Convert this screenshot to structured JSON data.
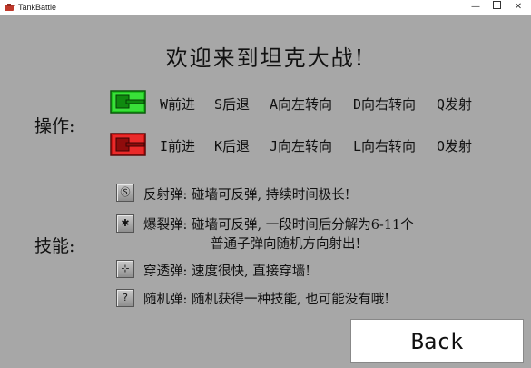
{
  "window": {
    "title": "TankBattle",
    "min_glyph": "—",
    "close_glyph": "✕"
  },
  "welcome": "欢迎来到坦克大战!",
  "operations": {
    "label": "操作:",
    "player1": {
      "tank_color": "#1fc41f",
      "keys": [
        "W前进",
        "S后退",
        "A向左转向",
        "D向右转向",
        "Q发射"
      ]
    },
    "player2": {
      "tank_color": "#d01414",
      "keys": [
        "I前进",
        "K后退",
        "J向左转向",
        "L向右转向",
        "O发射"
      ]
    }
  },
  "skills": {
    "label": "技能:",
    "items": [
      {
        "icon": "reflect-icon",
        "glyph": "Ⓢ",
        "text": "反射弹: 碰墙可反弹, 持续时间极长!"
      },
      {
        "icon": "explode-icon",
        "glyph": "✱",
        "text": "爆裂弹: 碰墙可反弹, 一段时间后分解为6-11个",
        "text2": "普通子弹向随机方向射出!"
      },
      {
        "icon": "pierce-icon",
        "glyph": "⊹",
        "text": "穿透弹: 速度很快, 直接穿墙!"
      },
      {
        "icon": "random-icon",
        "glyph": "?",
        "text": "随机弹: 随机获得一种技能, 也可能没有哦!"
      }
    ]
  },
  "back_label": "Back"
}
